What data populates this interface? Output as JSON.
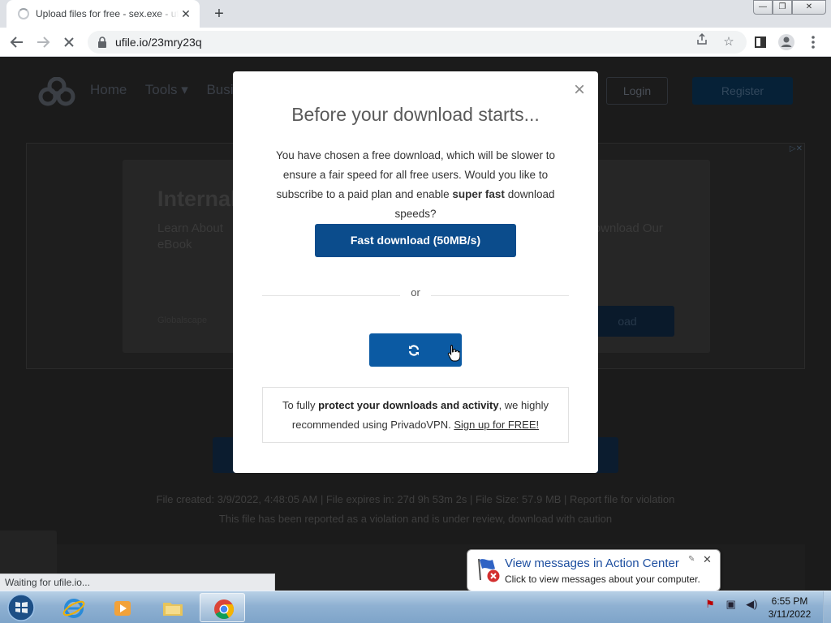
{
  "browser": {
    "tab_title": "Upload files for free - sex.exe - ufile.io",
    "tab_close": "✕",
    "new_tab": "+",
    "url": "ufile.io/23mry23q",
    "window_controls": {
      "minimize": "—",
      "maximize": "❐",
      "close": "✕"
    },
    "status_text": "Waiting for ufile.io..."
  },
  "site": {
    "nav": [
      "Home",
      "Tools ▾",
      "Business"
    ],
    "login": "Login",
    "register": "Register"
  },
  "ad": {
    "headline": "Internal",
    "line1": "Learn About",
    "line2": "eBook",
    "right_text": "Download Our",
    "footer": "Globalscape",
    "button": "oad"
  },
  "file_info": {
    "line1": "File created: 3/9/2022, 4:48:05 AM   |   File expires in: 27d 9h 53m 2s   |   File Size: 57.9 MB   |   Report file for violation",
    "line2": "This file has been reported as a violation and is under review, download with caution"
  },
  "modal": {
    "close": "×",
    "title": "Before your download starts...",
    "text_pre": "You have chosen a free download, which will be slower to ensure a fair speed for all free users. Would you like to subscribe to a paid plan and enable ",
    "text_bold": "super fast",
    "text_post": " download speeds?",
    "fast_button": "Fast download (50MB/s)",
    "or": "or",
    "vpn_pre": "To fully ",
    "vpn_bold": "protect your downloads and activity",
    "vpn_mid": ", we highly recommended using PrivadoVPN. ",
    "vpn_link": "Sign up for FREE!"
  },
  "action_center": {
    "title": "View messages in Action Center",
    "subtitle": "Click to view messages about your computer.",
    "close": "✕"
  },
  "taskbar": {
    "time": "6:55 PM",
    "date": "3/11/2022"
  },
  "colors": {
    "primary_button": "#0b4c8c",
    "overlay": "#1b1b1b"
  }
}
